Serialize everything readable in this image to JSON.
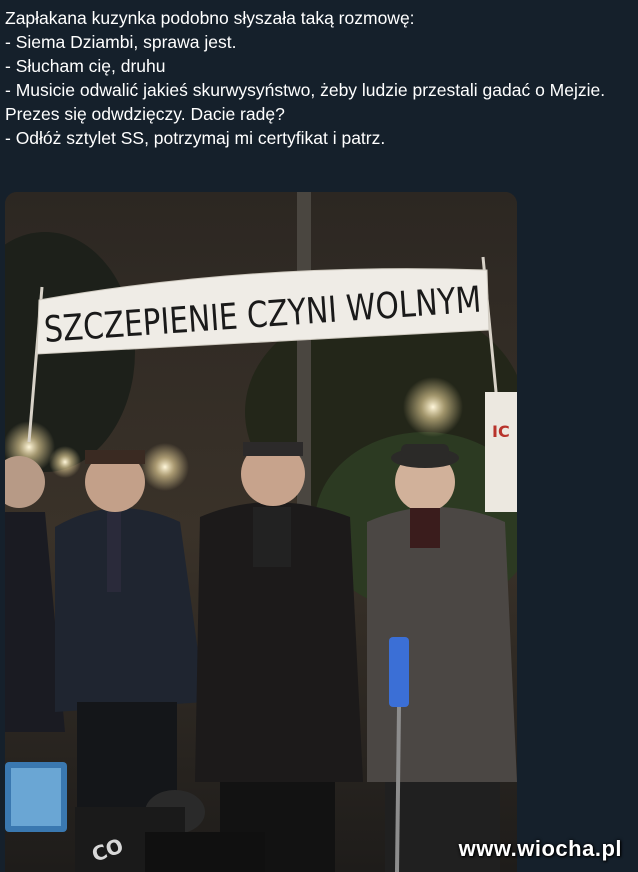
{
  "post": {
    "lines": [
      "Zapłakana kuzynka podobno słyszała taką rozmowę:",
      "- Siema Dziambi, sprawa jest.",
      "- Słucham cię, druhu",
      "- Musicie odwalić jakieś skurwysyństwo, żeby ludzie przestali gadać o Mejzie. Prezes się odwdzięczy. Dacie radę?",
      "- Odłóż sztylet SS, potrzymaj mi certyfikat i patrz."
    ]
  },
  "media": {
    "banner_text": "SZCZEPIENIE CZYNI WOLNYM",
    "sign_fragment": "IC",
    "camera_text": "CO"
  },
  "watermark": {
    "text": "www.wiocha.pl"
  },
  "colors": {
    "background": "#15202b",
    "text": "#ffffff"
  }
}
